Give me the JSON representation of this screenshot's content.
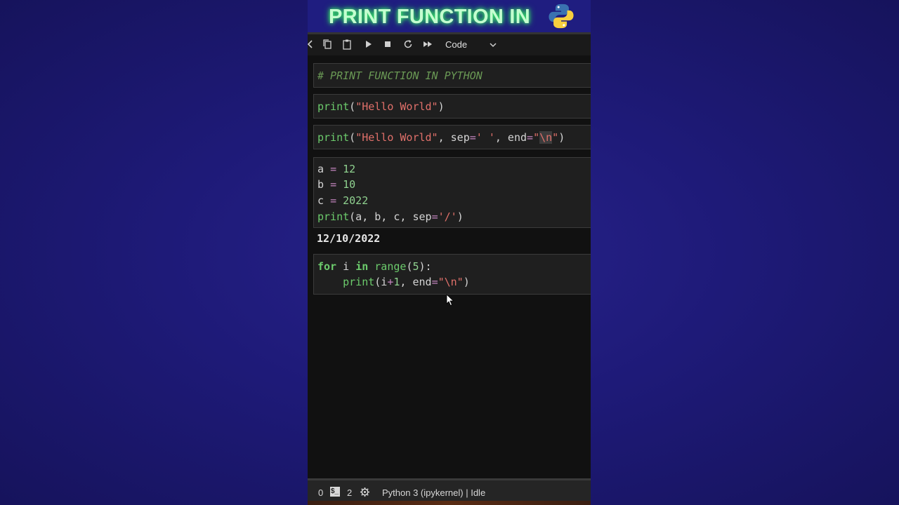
{
  "banner": {
    "title": "PRINT FUNCTION IN",
    "logo_icon": "python-logo-icon"
  },
  "toolbar": {
    "icons": [
      "back-icon",
      "copy-icon",
      "paste-icon",
      "run-icon",
      "stop-icon",
      "restart-icon",
      "run-all-icon"
    ],
    "cell_type": "Code",
    "dropdown_icon": "chevron-down-icon"
  },
  "cells": {
    "c1": {
      "comment": "# PRINT FUNCTION IN PYTHON"
    },
    "c2": {
      "fn": "print",
      "p1": "(",
      "s1": "\"Hello World\"",
      "p2": ")"
    },
    "c3": {
      "fn": "print",
      "p1": "(",
      "s1": "\"Hello World\"",
      "t1": ", sep",
      "eq1": "=",
      "s2": "' '",
      "t2": ", end",
      "eq2": "=",
      "q1": "\"",
      "esc": "\\n",
      "q2": "\"",
      "p2": ")"
    },
    "c4": {
      "l1": {
        "v": "a ",
        "op": "=",
        "n": " 12"
      },
      "l2": {
        "v": "b ",
        "op": "=",
        "n": " 10"
      },
      "l3": {
        "v": "c ",
        "op": "=",
        "n": " 2022"
      },
      "l4": {
        "fn": "print",
        "args": "(a, b, c, sep",
        "eq": "=",
        "s": "'/'",
        "p": ")"
      }
    },
    "c5": {
      "l1": {
        "kw1": "for",
        "i": " i ",
        "kw2": "in",
        "sp": " ",
        "fn": "range",
        "p1": "(",
        "n": "5",
        "p2": "):"
      },
      "l2": {
        "ind": "    ",
        "fn": "print",
        "a1": "(i",
        "op": "+",
        "n": "1",
        "a2": ", end",
        "eq": "=",
        "s": "\"\\n\"",
        "p": ")"
      }
    }
  },
  "output": "12/10/2022",
  "statusbar": {
    "zero": "0",
    "terminal_icon": "$_",
    "two": "2",
    "gear_icon": "gear-icon",
    "kernel": "Python 3 (ipykernel) | Idle"
  },
  "colors": {
    "accent_green": "#c4ffd0",
    "background": "#1e1a78",
    "string": "#e0706a",
    "keyword": "#6ccb6c"
  }
}
